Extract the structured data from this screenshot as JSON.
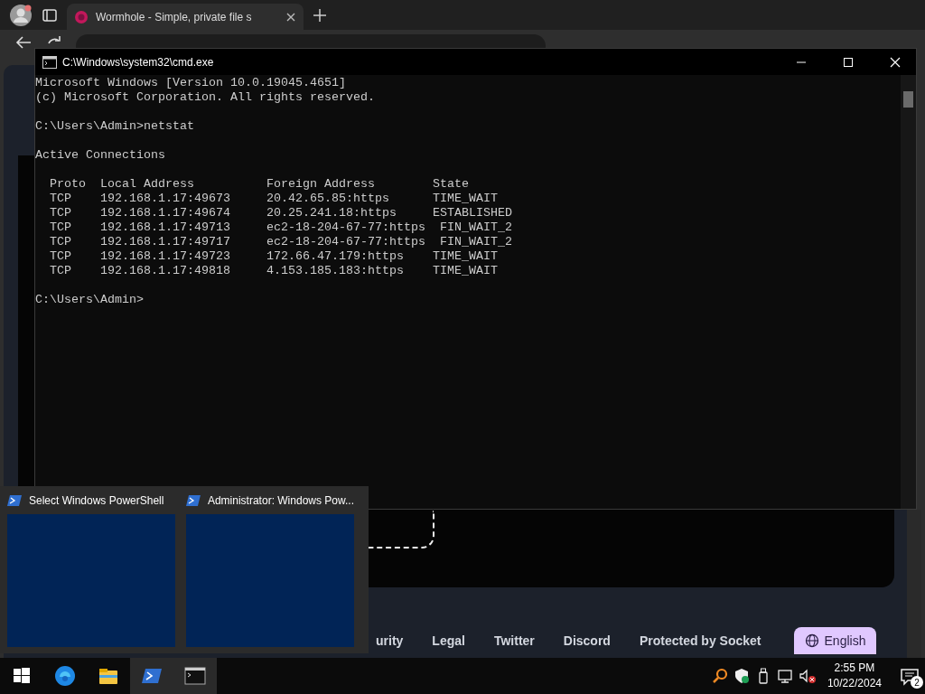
{
  "browser": {
    "tab": {
      "title": "Wormhole - Simple, private file s"
    },
    "page": {
      "footer_links": [
        "urity",
        "Legal",
        "Twitter",
        "Discord",
        "Protected by Socket"
      ],
      "language_button": "English"
    }
  },
  "cmd": {
    "title": "C:\\Windows\\system32\\cmd.exe",
    "banner": [
      "Microsoft Windows [Version 10.0.19045.4651]",
      "(c) Microsoft Corporation. All rights reserved."
    ],
    "command": "C:\\Users\\Admin>netstat",
    "heading": "Active Connections",
    "columns": [
      "Proto",
      "Local Address",
      "Foreign Address",
      "State"
    ],
    "rows": [
      {
        "proto": "TCP",
        "local": "192.168.1.17:49673",
        "foreign": "20.42.65.85:https",
        "state": "TIME_WAIT"
      },
      {
        "proto": "TCP",
        "local": "192.168.1.17:49674",
        "foreign": "20.25.241.18:https",
        "state": "ESTABLISHED"
      },
      {
        "proto": "TCP",
        "local": "192.168.1.17:49713",
        "foreign": "ec2-18-204-67-77:https",
        "state": "FIN_WAIT_2"
      },
      {
        "proto": "TCP",
        "local": "192.168.1.17:49717",
        "foreign": "ec2-18-204-67-77:https",
        "state": "FIN_WAIT_2"
      },
      {
        "proto": "TCP",
        "local": "192.168.1.17:49723",
        "foreign": "172.66.47.179:https",
        "state": "TIME_WAIT"
      },
      {
        "proto": "TCP",
        "local": "192.168.1.17:49818",
        "foreign": "4.153.185.183:https",
        "state": "TIME_WAIT"
      }
    ],
    "prompt": "C:\\Users\\Admin>"
  },
  "thumbnails": [
    {
      "title": "Select Windows PowerShell"
    },
    {
      "title": "Administrator: Windows Pow..."
    }
  ],
  "taskbar": {
    "time": "2:55 PM",
    "date": "10/22/2024",
    "notification_count": "2"
  }
}
